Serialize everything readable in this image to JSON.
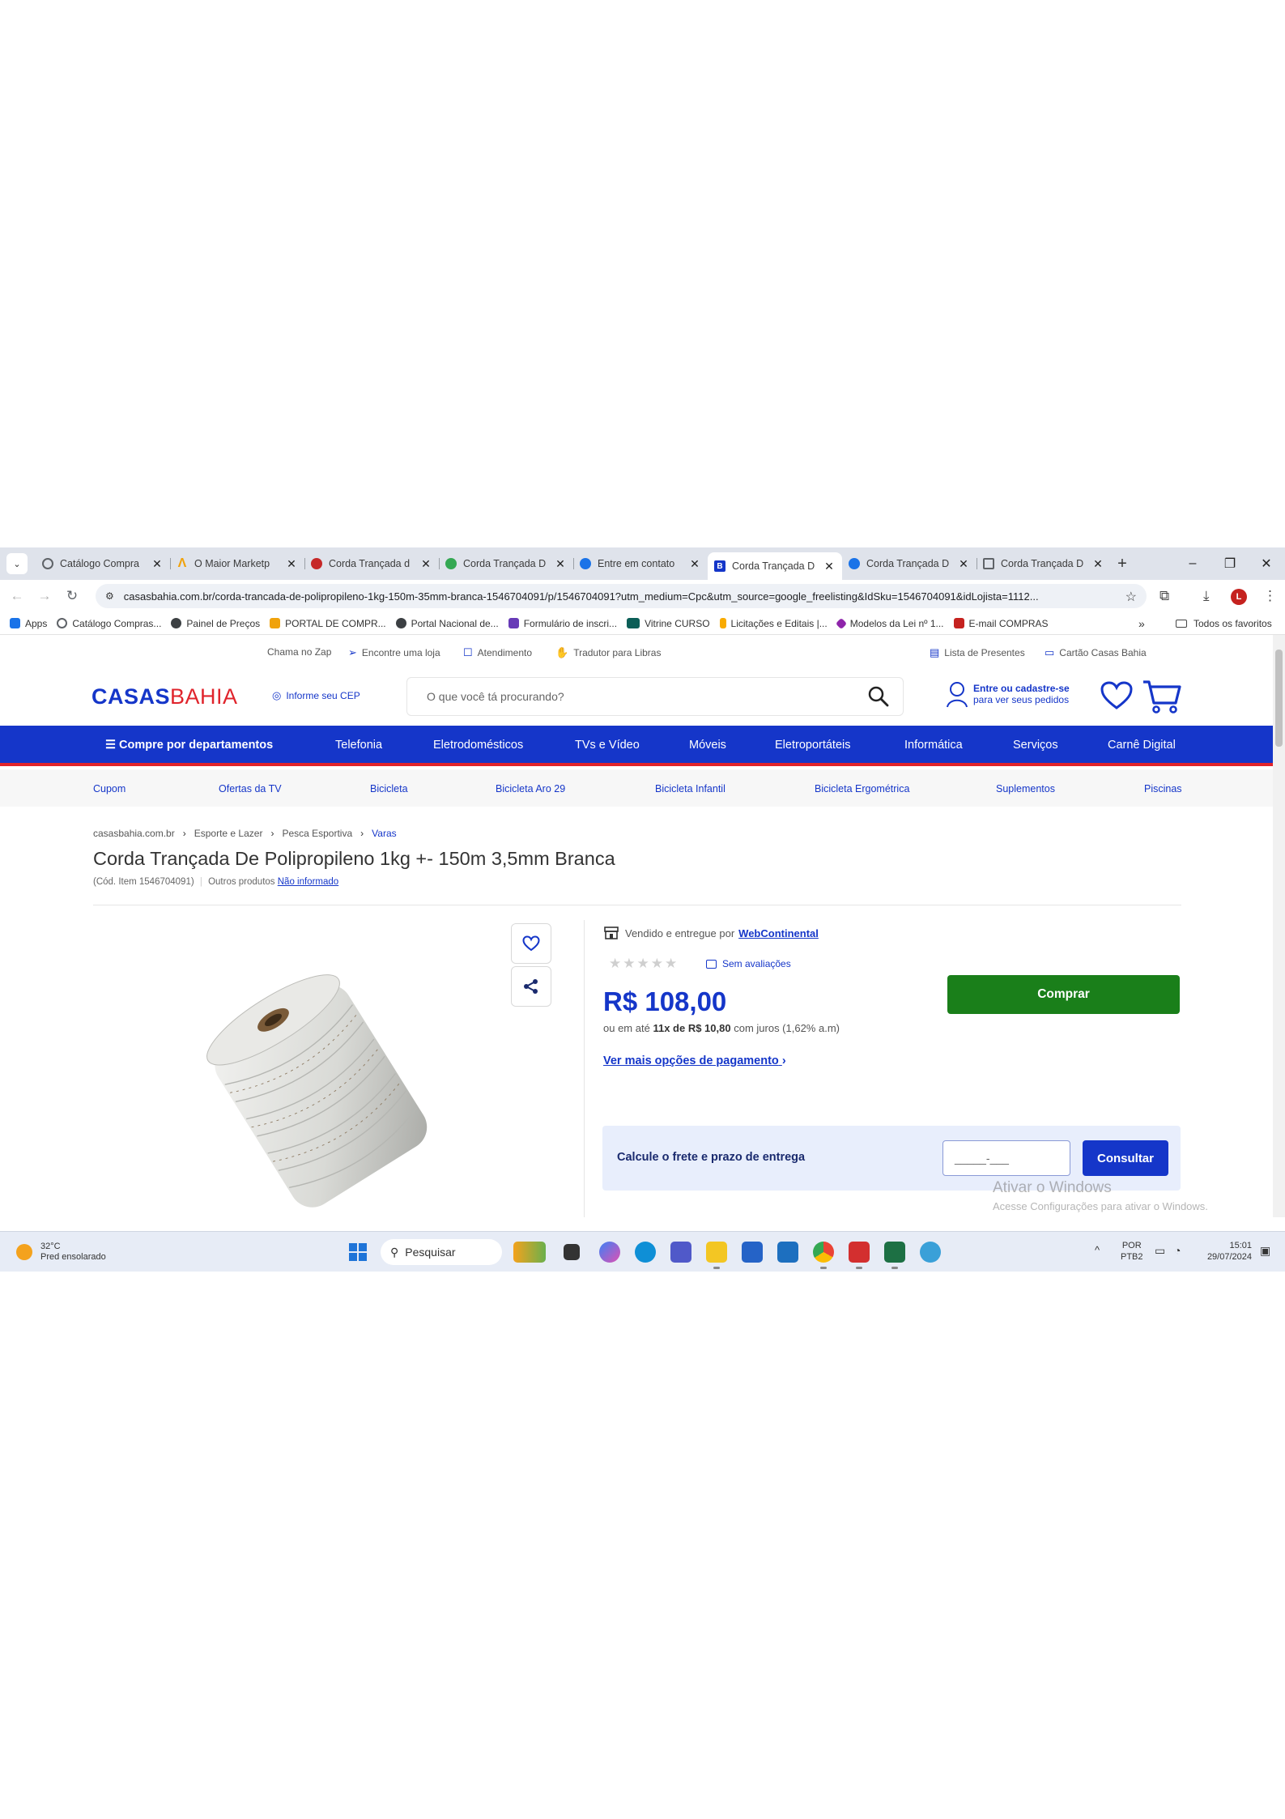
{
  "browser": {
    "tabs": [
      {
        "title": "Catálogo Compra",
        "color": "#5f6368",
        "active": false
      },
      {
        "title": "O Maior Marketp",
        "color": "#f0a20b",
        "active": false
      },
      {
        "title": "Corda Trançada d",
        "color": "#c62828",
        "active": false
      },
      {
        "title": "Corda Trançada D",
        "color": "#34a853",
        "active": false
      },
      {
        "title": "Entre em contato",
        "color": "#1a73e8",
        "active": false
      },
      {
        "title": "Corda Trançada D",
        "color": "#1536c9",
        "active": true
      },
      {
        "title": "Corda Trançada D",
        "color": "#1a73e8",
        "active": false
      },
      {
        "title": "Corda Trançada D",
        "color": "#5f6368",
        "active": false
      }
    ],
    "url": "casasbahia.com.br/corda-trancada-de-polipropileno-1kg-150m-35mm-branca-1546704091/p/1546704091?utm_medium=Cpc&utm_source=google_freelisting&IdSku=1546704091&idLojista=1112...",
    "profile_initial": "L",
    "bookmarks": [
      {
        "label": "Apps",
        "color": "#1a73e8"
      },
      {
        "label": "Catálogo Compras...",
        "color": "#5f6368"
      },
      {
        "label": "Painel de Preços",
        "color": "#3c4043"
      },
      {
        "label": "PORTAL DE COMPR...",
        "color": "#f0a20b"
      },
      {
        "label": "Portal Nacional de...",
        "color": "#3c4043"
      },
      {
        "label": "Formulário de inscri...",
        "color": "#673ab7"
      },
      {
        "label": "Vitrine CURSO",
        "color": "#0b5e57"
      },
      {
        "label": "Licitações e Editais |...",
        "color": "#f9ab00"
      },
      {
        "label": "Modelos da Lei nº 1...",
        "color": "#8e24aa"
      },
      {
        "label": "E-mail COMPRAS",
        "color": "#c5221f"
      }
    ],
    "bookmarks_more": "»",
    "all_bookmarks": "Todos os favoritos"
  },
  "site": {
    "util_links": [
      "Chama no Zap",
      "Encontre uma loja",
      "Atendimento",
      "Tradutor para Libras"
    ],
    "util_right": [
      "Lista de Presentes",
      "Cartão Casas Bahia"
    ],
    "logo_a": "CASAS",
    "logo_b": "BAHIA",
    "cep_label": "Informe seu CEP",
    "search_placeholder": "O que você tá procurando?",
    "login_l1": "Entre ou cadastre-se",
    "login_l2": "para ver seus pedidos",
    "departments": [
      "Compre por departamentos",
      "Telefonia",
      "Eletrodomésticos",
      "TVs e Vídeo",
      "Móveis",
      "Eletroportáteis",
      "Informática",
      "Serviços",
      "Carnê Digital"
    ],
    "subnav": [
      "Cupom",
      "Ofertas da TV",
      "Bicicleta",
      "Bicicleta Aro 29",
      "Bicicleta Infantil",
      "Bicicleta Ergométrica",
      "Suplementos",
      "Piscinas"
    ],
    "breadcrumbs": [
      "casasbahia.com.br",
      "Esporte e Lazer",
      "Pesca Esportiva",
      "Varas"
    ],
    "product_title": "Corda Trançada De Polipropileno 1kg +- 150m 3,5mm Branca",
    "item_code": "(Cód. Item 1546704091)",
    "other_products": "Outros produtos",
    "brand": "Não informado",
    "sold_by": "Vendido e entregue por",
    "seller": "WebContinental",
    "rating": 0,
    "stars": "★★★★★",
    "reviews": "Sem avaliações",
    "price": "R$ 108,00",
    "install_pre": "ou em até",
    "install_bold": "11x de R$ 10,80",
    "install_post": "com juros (1,62% a.m)",
    "more_payment": "Ver mais opções de pagamento",
    "buy_label": "Comprar",
    "freight_label": "Calcule o frete e prazo de entrega",
    "cep_placeholder": "_____-___",
    "consult_label": "Consultar"
  },
  "windows": {
    "watermark_title": "Ativar o Windows",
    "watermark_sub": "Acesse Configurações para ativar o Windows.",
    "weather_temp": "32°C",
    "weather_desc": "Pred ensolarado",
    "search_label": "Pesquisar",
    "lang1": "POR",
    "lang2": "PTB2",
    "time": "15:01",
    "date": "29/07/2024"
  }
}
